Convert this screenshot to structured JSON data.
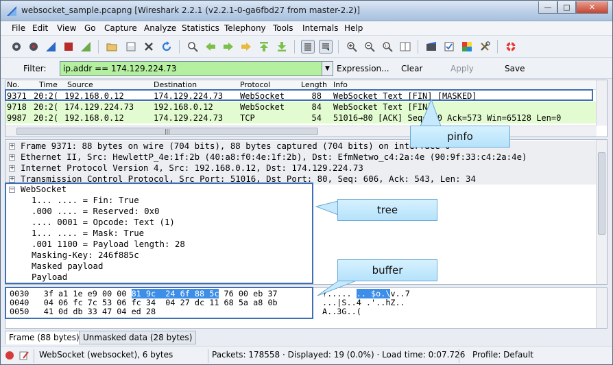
{
  "window": {
    "title": "websocket_sample.pcapng [Wireshark 2.2.1 (v2.2.1-0-ga6fbd27 from master-2.2)]",
    "min": "—",
    "max": "□",
    "close": "✕"
  },
  "menu": [
    "File",
    "Edit",
    "View",
    "Go",
    "Capture",
    "Analyze",
    "Statistics",
    "Telephony",
    "Tools",
    "Internals",
    "Help"
  ],
  "toolbar": {
    "icons": [
      "interfaces-icon",
      "options-icon",
      "start-capture-icon",
      "stop-capture-icon",
      "restart-capture-icon",
      "open-file-icon",
      "save-file-icon",
      "close-file-icon",
      "reload-icon",
      "find-icon",
      "go-back-icon",
      "go-forward-icon",
      "go-to-packet-icon",
      "first-packet-icon",
      "last-packet-icon",
      "autoscroll-icon",
      "colorize-icon",
      "zoom-in-icon",
      "zoom-out-icon",
      "zoom-normal-icon",
      "resize-columns-icon",
      "capture-filters-icon",
      "display-filters-icon",
      "coloring-rules-icon",
      "preferences-icon",
      "help-icon"
    ]
  },
  "filter": {
    "label": "Filter:",
    "value": "ip.addr == 174.129.224.73",
    "expression": "Expression...",
    "clear": "Clear",
    "apply": "Apply",
    "save": "Save"
  },
  "packet_list": {
    "columns": [
      "No.",
      "Time",
      "Source",
      "Destination",
      "Protocol",
      "Length",
      "Info"
    ],
    "rows": [
      {
        "no": "9371",
        "time": "20:2(",
        "src": "192.168.0.12",
        "dst": "174.129.224.73",
        "proto": "WebSocket",
        "len": "88",
        "info": "WebSocket Text [FIN] [MASKED]",
        "bg": "#ffffff",
        "fg": "#000000"
      },
      {
        "no": "9718",
        "time": "20:2(",
        "src": "174.129.224.73",
        "dst": "192.168.0.12",
        "proto": "WebSocket",
        "len": "84",
        "info": "WebSocket Text [FIN]",
        "bg": "#e3fbd0",
        "fg": "#000000"
      },
      {
        "no": "9987",
        "time": "20:2(",
        "src": "192.168.0.12",
        "dst": "174.129.224.73",
        "proto": "TCP",
        "len": "54",
        "info": "51016→80 [ACK] Seq=640 Ack=573 Win=65128 Len=0",
        "bg": "#e3fbd0",
        "fg": "#000000"
      }
    ]
  },
  "tree": {
    "top": [
      "Frame 9371: 88 bytes on wire (704 bits), 88 bytes captured (704 bits) on interface 0",
      "Ethernet II, Src: HewlettP_4e:1f:2b (40:a8:f0:4e:1f:2b), Dst: EfmNetwo_c4:2a:4e (90:9f:33:c4:2a:4e)",
      "Internet Protocol Version 4, Src: 192.168.0.12, Dst: 174.129.224.73",
      "Transmission Control Protocol, Src Port: 51016, Dst Port: 80, Seq: 606, Ack: 543, Len: 34"
    ],
    "ws_label": "WebSocket",
    "ws_fields": [
      "1... .... = Fin: True",
      ".000 .... = Reserved: 0x0",
      ".... 0001 = Opcode: Text (1)",
      "1... .... = Mask: True",
      ".001 1100 = Payload length: 28",
      "Masking-Key: 246f885c",
      "Masked payload",
      "Payload"
    ]
  },
  "bytes": [
    {
      "off": "0030",
      "pre": "3f a1 1e e9 00 00 ",
      "hl": "81 9c  24 6f 88 5c",
      "post": " 76 00 eb 37",
      "ascii_pre": "?..... ",
      "ascii_hl": ".. $o.\\",
      "ascii_post": "v..7"
    },
    {
      "off": "0040",
      "pre": "04 06 fc 7c 53 06 fc 34  04 27 dc 11 68 5a a8 0b",
      "hl": "",
      "post": "",
      "ascii_pre": "...|S..4 .'..hZ..",
      "ascii_hl": "",
      "ascii_post": ""
    },
    {
      "off": "0050",
      "pre": "41 0d db 33 47 04 ed 28",
      "hl": "",
      "post": "",
      "ascii_pre": "A..3G..(",
      "ascii_hl": "",
      "ascii_post": ""
    }
  ],
  "tabs": [
    "Frame (88 bytes)",
    "Unmasked data (28 bytes)"
  ],
  "status": {
    "proto": "WebSocket (websocket), 6 bytes",
    "packets": "Packets: 178558 · Displayed: 19 (0.0%) · Load time: 0:07.726",
    "profile": "Profile: Default"
  },
  "callouts": {
    "pinfo": "pinfo",
    "tree": "tree",
    "buffer": "buffer"
  },
  "colors": {
    "selected_row_border": "#3f6fb2",
    "filter_ok": "#b4f0a0",
    "highlight": "#3d8ee8"
  }
}
